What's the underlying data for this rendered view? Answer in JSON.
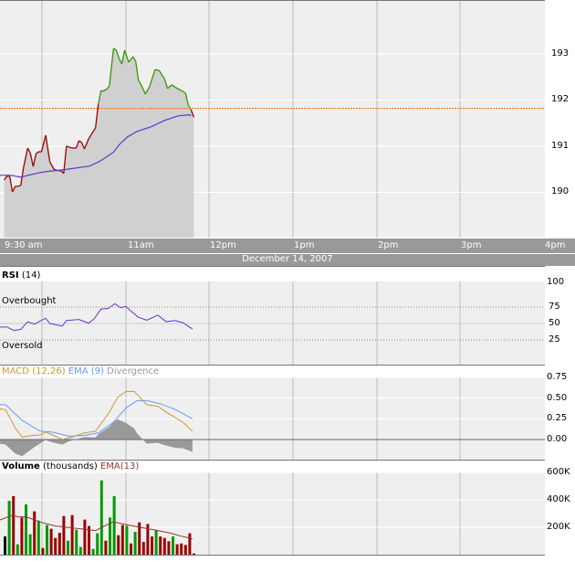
{
  "chart_data": [
    {
      "type": "line",
      "panel": "price",
      "xunit": "minutes since 9:30 am",
      "date": "December 14, 2007",
      "xticks": [
        "9:30 am",
        "11am",
        "12pm",
        "1pm",
        "2pm",
        "3pm",
        "4pm"
      ],
      "yticks": [
        "193",
        "192",
        "191",
        "190"
      ],
      "ylim": [
        189.0,
        194.2
      ],
      "reference_price": 191.82,
      "price": [
        [
          3,
          190.27
        ],
        [
          5,
          190.35
        ],
        [
          7,
          190.35
        ],
        [
          9,
          190.01
        ],
        [
          11,
          190.13
        ],
        [
          13,
          190.13
        ],
        [
          15,
          190.15
        ],
        [
          17,
          190.54
        ],
        [
          20,
          190.96
        ],
        [
          22,
          190.84
        ],
        [
          24,
          190.56
        ],
        [
          26,
          190.84
        ],
        [
          28,
          190.88
        ],
        [
          30,
          190.88
        ],
        [
          33,
          191.24
        ],
        [
          36,
          190.66
        ],
        [
          39,
          190.5
        ],
        [
          42,
          190.47
        ],
        [
          44,
          190.47
        ],
        [
          46,
          190.41
        ],
        [
          48,
          191.0
        ],
        [
          50,
          190.98
        ],
        [
          52,
          190.96
        ],
        [
          55,
          190.96
        ],
        [
          57,
          191.12
        ],
        [
          59,
          191.08
        ],
        [
          61,
          190.94
        ],
        [
          64,
          191.16
        ],
        [
          69,
          191.4
        ],
        [
          71,
          191.91
        ],
        [
          73,
          192.21
        ],
        [
          74,
          192.19
        ],
        [
          77,
          192.23
        ],
        [
          79,
          192.31
        ],
        [
          82,
          193.12
        ],
        [
          84,
          193.08
        ],
        [
          86,
          192.9
        ],
        [
          88,
          192.78
        ],
        [
          90,
          193.08
        ],
        [
          93,
          192.82
        ],
        [
          96,
          192.94
        ],
        [
          98,
          192.84
        ],
        [
          100,
          192.43
        ],
        [
          102,
          192.33
        ],
        [
          105,
          192.13
        ],
        [
          108,
          192.29
        ],
        [
          112,
          192.66
        ],
        [
          115,
          192.64
        ],
        [
          119,
          192.45
        ],
        [
          121,
          192.25
        ],
        [
          124,
          192.33
        ],
        [
          127,
          192.27
        ],
        [
          132,
          192.19
        ],
        [
          134,
          192.15
        ],
        [
          136,
          191.89
        ],
        [
          138,
          191.79
        ],
        [
          140,
          191.63
        ]
      ],
      "ema": [
        [
          0,
          190.37
        ],
        [
          8,
          190.37
        ],
        [
          15,
          190.33
        ],
        [
          26,
          190.41
        ],
        [
          33,
          190.45
        ],
        [
          46,
          190.49
        ],
        [
          65,
          190.57
        ],
        [
          73,
          190.69
        ],
        [
          82,
          190.87
        ],
        [
          86,
          191.03
        ],
        [
          92,
          191.2
        ],
        [
          99,
          191.32
        ],
        [
          109,
          191.42
        ],
        [
          119,
          191.56
        ],
        [
          129,
          191.66
        ],
        [
          137,
          191.68
        ],
        [
          138,
          191.66
        ]
      ],
      "colors": {
        "up": "#339900",
        "down": "#990000",
        "ema": "#6633cc",
        "reference": "#ff6600",
        "fill": "#d0d0d0"
      }
    },
    {
      "type": "line",
      "panel": "rsi",
      "title": "RSI",
      "param": "(14)",
      "overbought_label": "Overbought",
      "oversold_label": "Oversold",
      "yticks": [
        "100",
        "75",
        "50",
        "25"
      ],
      "levels": [
        75,
        25
      ],
      "values": [
        [
          0,
          44.7
        ],
        [
          5,
          44.7
        ],
        [
          10,
          39.5
        ],
        [
          15,
          41
        ],
        [
          20,
          52.7
        ],
        [
          25,
          49
        ],
        [
          28,
          52.7
        ],
        [
          33,
          58
        ],
        [
          36,
          50
        ],
        [
          45,
          46
        ],
        [
          48,
          54.5
        ],
        [
          57,
          56
        ],
        [
          64,
          50.5
        ],
        [
          68,
          57
        ],
        [
          73,
          72
        ],
        [
          78,
          72.7
        ],
        [
          83,
          80
        ],
        [
          87,
          74
        ],
        [
          91,
          76
        ],
        [
          95,
          68
        ],
        [
          100,
          59.5
        ],
        [
          106,
          55
        ],
        [
          114,
          62.7
        ],
        [
          120,
          52.7
        ],
        [
          126,
          54.5
        ],
        [
          132,
          51.4
        ],
        [
          135,
          47
        ],
        [
          139,
          41.8
        ]
      ],
      "color": "#6633cc"
    },
    {
      "type": "line",
      "panel": "macd",
      "title": "MACD",
      "param": "(12,26)",
      "ema_title": "EMA",
      "ema_param": "(9)",
      "div_title": "Divergence",
      "yticks": [
        "0.75",
        "0.50",
        "0.25",
        "0.00"
      ],
      "ylim": [
        -0.25,
        0.75
      ],
      "macd": [
        [
          0,
          0.37
        ],
        [
          4,
          0.36
        ],
        [
          11,
          0.14
        ],
        [
          16,
          0.03
        ],
        [
          20,
          0.04
        ],
        [
          24,
          0.05
        ],
        [
          29,
          0.055
        ],
        [
          33,
          0.09
        ],
        [
          38,
          0.055
        ],
        [
          45,
          0
        ],
        [
          52,
          0.03
        ],
        [
          61,
          0.08
        ],
        [
          69,
          0.1
        ],
        [
          79,
          0.33
        ],
        [
          85,
          0.51
        ],
        [
          91,
          0.58
        ],
        [
          97,
          0.58
        ],
        [
          102,
          0.49
        ],
        [
          106,
          0.42
        ],
        [
          114,
          0.4
        ],
        [
          122,
          0.31
        ],
        [
          132,
          0.21
        ],
        [
          139,
          0.1
        ]
      ],
      "ema": [
        [
          0,
          0.42
        ],
        [
          4,
          0.42
        ],
        [
          16,
          0.23
        ],
        [
          29,
          0.1
        ],
        [
          38,
          0.09
        ],
        [
          50,
          0.04
        ],
        [
          61,
          0.05
        ],
        [
          71,
          0.08
        ],
        [
          82,
          0.21
        ],
        [
          91,
          0.38
        ],
        [
          99,
          0.47
        ],
        [
          106,
          0.47
        ],
        [
          116,
          0.43
        ],
        [
          127,
          0.36
        ],
        [
          139,
          0.25
        ]
      ],
      "colors": {
        "macd": "#cc9933",
        "ema": "#6699ff",
        "divergence": "#999999"
      }
    },
    {
      "type": "bar",
      "panel": "volume",
      "title": "Volume",
      "param": "(thousands)",
      "ema_title": "EMA(13)",
      "yticks": [
        "600K",
        "400K",
        "200K"
      ],
      "ylim": [
        0,
        600
      ],
      "bar_interval_minutes": 3,
      "volumes": [
        133,
        393,
        427,
        76,
        271,
        367,
        149,
        316,
        249,
        49,
        216,
        189,
        122,
        160,
        282,
        102,
        289,
        182,
        56,
        256,
        209,
        42,
        156,
        542,
        102,
        271,
        427,
        142,
        216,
        211,
        82,
        167,
        236,
        93,
        224,
        133,
        178,
        133,
        122,
        98,
        133,
        76,
        82,
        71,
        156,
        9
      ],
      "directions": [
        "n",
        "u",
        "d",
        "u",
        "d",
        "u",
        "u",
        "d",
        "u",
        "d",
        "u",
        "d",
        "d",
        "d",
        "d",
        "u",
        "d",
        "u",
        "u",
        "d",
        "d",
        "u",
        "u",
        "u",
        "d",
        "u",
        "u",
        "d",
        "d",
        "u",
        "d",
        "u",
        "d",
        "d",
        "d",
        "d",
        "u",
        "d",
        "d",
        "d",
        "u",
        "d",
        "d",
        "d",
        "d",
        "d"
      ],
      "ema": [
        [
          0,
          253
        ],
        [
          9,
          289
        ],
        [
          13,
          276
        ],
        [
          19,
          276
        ],
        [
          29,
          238
        ],
        [
          40,
          209
        ],
        [
          48,
          200
        ],
        [
          58,
          189
        ],
        [
          69,
          176
        ],
        [
          79,
          227
        ],
        [
          82,
          240
        ],
        [
          90,
          222
        ],
        [
          101,
          200
        ],
        [
          111,
          182
        ],
        [
          122,
          160
        ],
        [
          130,
          138
        ],
        [
          139,
          116
        ]
      ],
      "colors": {
        "up": "#009900",
        "down": "#990000",
        "neutral": "#000000",
        "ema": "#993333"
      }
    }
  ]
}
